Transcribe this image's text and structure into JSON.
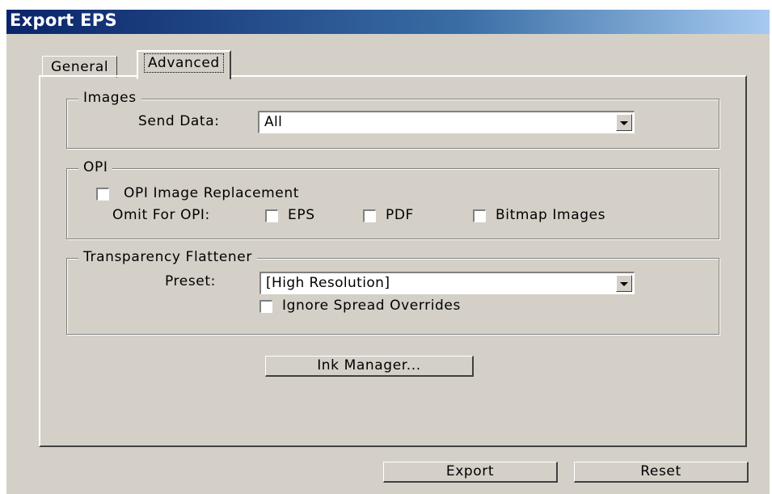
{
  "window": {
    "title": "Export EPS"
  },
  "tabs": {
    "general": "General",
    "advanced": "Advanced"
  },
  "images": {
    "group_label": "Images",
    "send_data_label": "Send Data:",
    "send_data_value": "All"
  },
  "opi": {
    "group_label": "OPI",
    "replacement_label": "OPI Image Replacement",
    "replacement_checked": false,
    "omit_label": "Omit For OPI:",
    "eps_label": "EPS",
    "pdf_label": "PDF",
    "bitmap_label": "Bitmap Images"
  },
  "transparency": {
    "group_label": "Transparency Flattener",
    "preset_label": "Preset:",
    "preset_value": "[High Resolution]",
    "ignore_label": "Ignore Spread Overrides"
  },
  "ink_manager": "Ink Manager...",
  "footer": {
    "export": "Export",
    "reset": "Reset"
  }
}
